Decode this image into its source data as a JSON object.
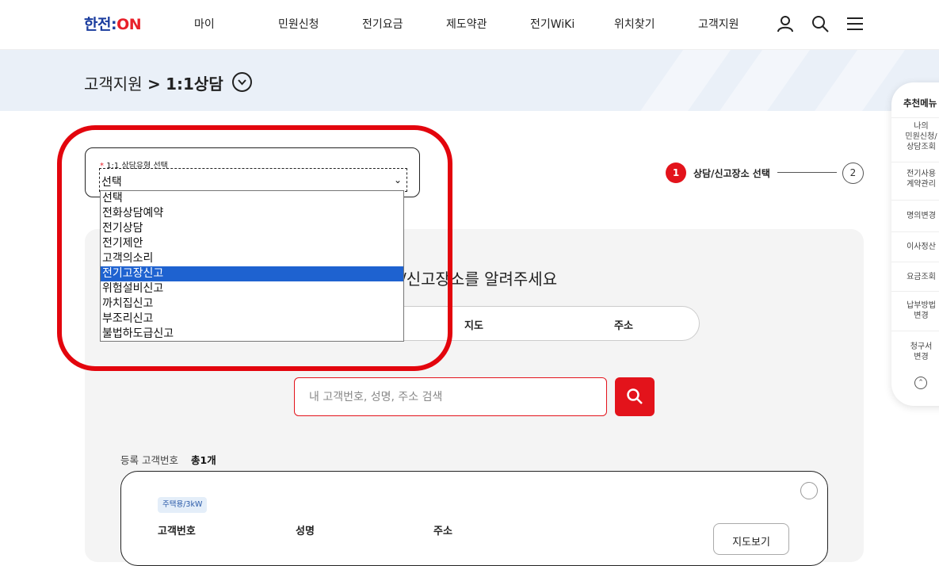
{
  "header": {
    "logo_main": "한전:",
    "logo_on": "ON",
    "nav": [
      "마이",
      "민원신청",
      "전기요금",
      "제도약관",
      "전기WiKi",
      "위치찾기",
      "고객지원"
    ],
    "icons": [
      "user-icon",
      "search-icon",
      "menu-icon"
    ]
  },
  "breadcrumb": {
    "parent": "고객지원",
    "separator": ">",
    "current": "1:1상담"
  },
  "form": {
    "required_mark": "*",
    "label": "1:1 상담유형 선택",
    "selected_value": "선택",
    "options": [
      "선택",
      "전화상담예약",
      "전기상담",
      "전기제안",
      "고객의소리",
      "전기고장신고",
      "위험설비신고",
      "까치집신고",
      "부조리신고",
      "불법하도급신고"
    ],
    "highlighted_option": "전기고장신고"
  },
  "steps": {
    "step1_number": "1",
    "step1_label": "상담/신고장소 선택",
    "step2_number": "2"
  },
  "panel": {
    "title_visible": "/신고장소를 알려주세요",
    "tabs": [
      "지도",
      "주소"
    ],
    "search_placeholder": "내 고객번호, 성명, 주소 검색",
    "count_label": "등록 고객번호",
    "count_value": "총1개"
  },
  "card": {
    "badge": "주택용/3kW",
    "col_customer_no": "고객번호",
    "col_name": "성명",
    "col_address": "주소",
    "map_button": "지도보기"
  },
  "side_menu": {
    "title": "추천메뉴",
    "items": [
      "나의\n민원신청/\n상담조회",
      "전기사용\n계약관리",
      "명의변경",
      "이사정산",
      "요금조회",
      "납부방법\n변경",
      "청구서\n변경"
    ]
  },
  "colors": {
    "brand_red": "#e3131b",
    "brand_blue": "#1a3c9e",
    "selection_blue": "#1e62d0"
  }
}
